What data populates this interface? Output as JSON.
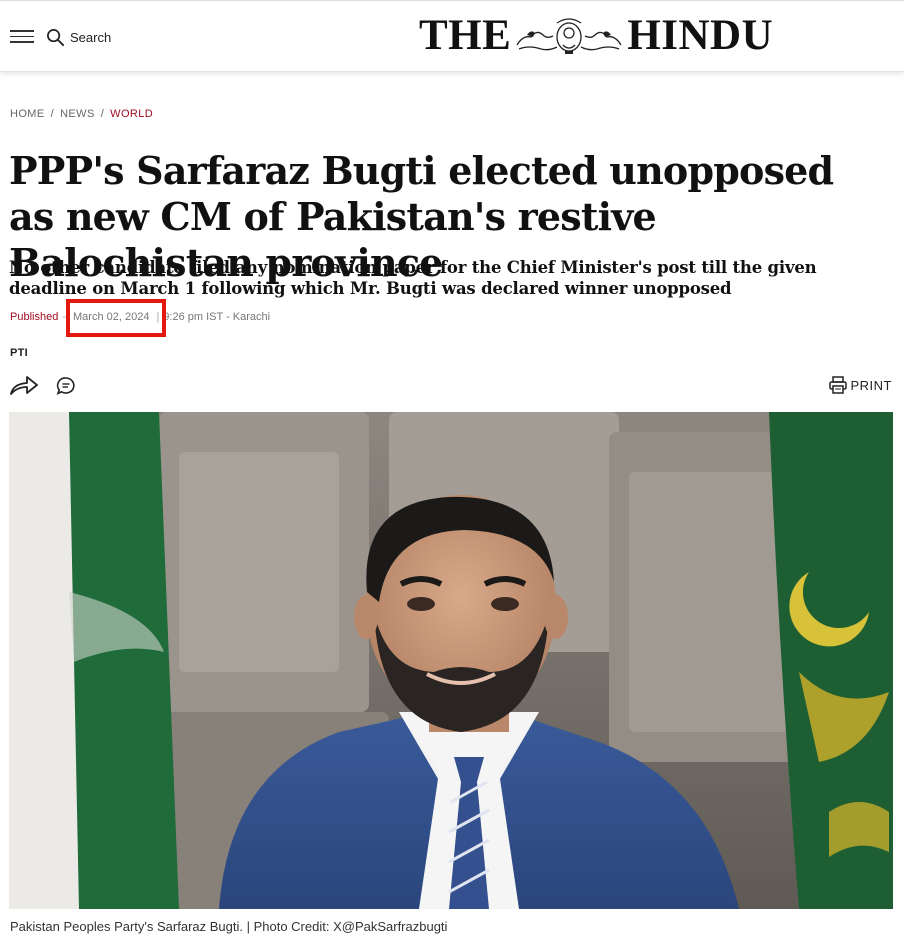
{
  "header": {
    "search_label": "Search",
    "logo_left": "THE",
    "logo_right": "HINDU"
  },
  "breadcrumb": [
    {
      "label": "HOME"
    },
    {
      "label": "NEWS"
    },
    {
      "label": "WORLD"
    }
  ],
  "article": {
    "headline": "PPP's Sarfaraz Bugti elected unopposed as new CM of Pakistan's restive Balochistan province",
    "subhead": "No other candidate filed any nomination paper for the Chief Minister's post till the given deadline on March 1 following which Mr. Bugti was declared winner unopposed",
    "published_label": "Published",
    "date": "March 02, 2024",
    "time": "9:26 pm IST - Karachi",
    "author": "PTI",
    "print_label": "PRINT",
    "caption": "Pakistan Peoples Party's Sarfaraz Bugti. | Photo Credit: X@PakSarfrazbugti"
  },
  "colors": {
    "accent": "#a00d1f",
    "highlight": "#e3190f"
  },
  "icons": [
    "menu-icon",
    "search-icon",
    "share-icon",
    "comment-icon",
    "print-icon"
  ]
}
